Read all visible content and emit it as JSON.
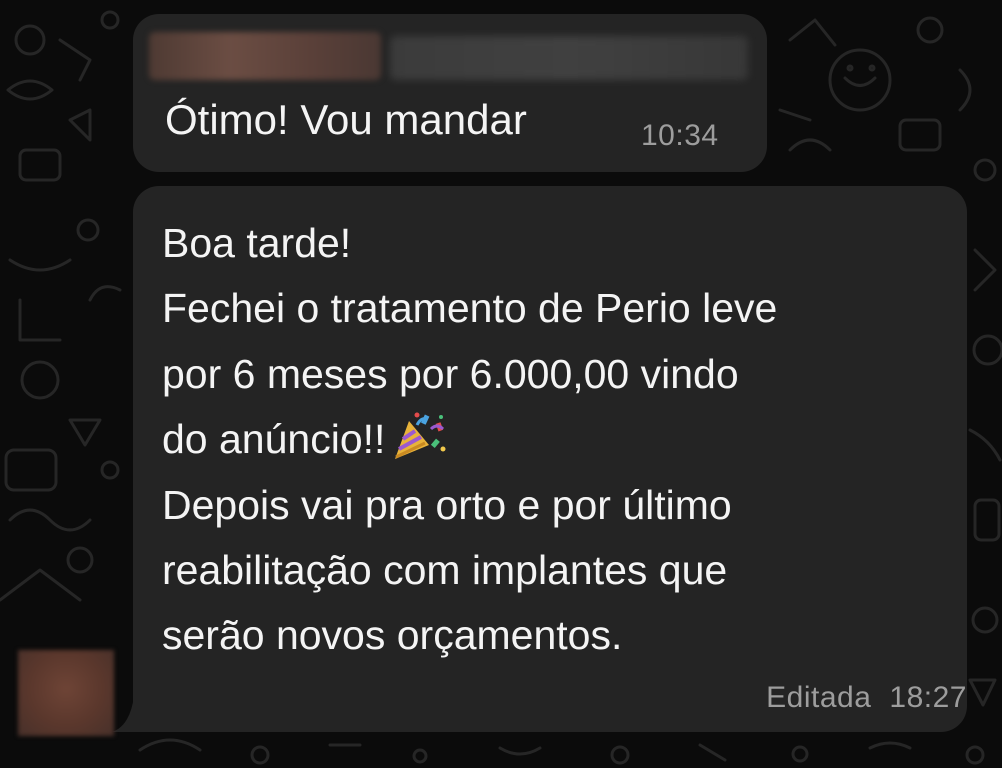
{
  "chat": {
    "background_color": "#0b0b0b",
    "bubble_color": "#242424",
    "messages": [
      {
        "text": "Ótimo! Vou mandar",
        "time": "10:34"
      },
      {
        "lines": [
          "Boa tarde!",
          "Fechei o tratamento de Perio leve",
          "por 6 meses por 6.000,00 vindo",
          "do anúncio!!",
          "Depois vai pra orto e por último",
          "reabilitação com implantes que",
          "serão novos orçamentos."
        ],
        "emoji": "party-popper-icon",
        "edited_label": "Editada",
        "time": "18:27"
      }
    ]
  }
}
